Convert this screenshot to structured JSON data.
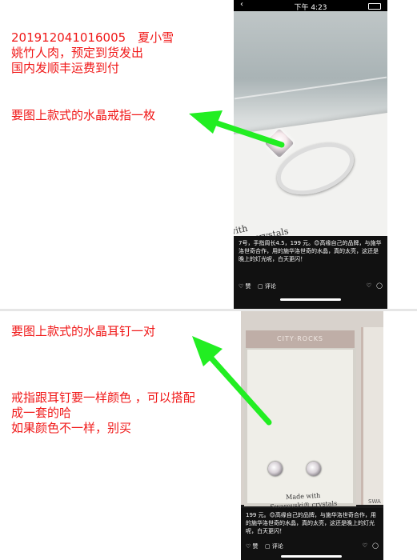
{
  "notes": {
    "order_line1": "201912041016005　夏小雪",
    "order_line2": "姚竹人肉，预定到货发出",
    "order_line3": "国内发顺丰运费到付",
    "ring_request": "要图上款式的水晶戒指一枚",
    "earring_request": "要图上款式的水晶耳钉一对",
    "color_line1": "戒指跟耳钉要一样颜色 ，可以搭配",
    "color_line2": "成一套的哈",
    "color_line3": "如果颜色不一样，别买"
  },
  "colors": {
    "note_text": "#f01818",
    "arrow": "#22ee22"
  },
  "phone_top": {
    "status_time": "下午 4:23",
    "back_glyph": "‹",
    "box_print": "with\nski® crystals",
    "caption": "7号，手指周长4.5，199 元。😊高缘自己的品牌，与施华洛世奇合作，用的施华洛世奇的水晶，真的太亮，这还是晚上的灯光呢，白天更闪！",
    "like_label": "♡ 赞",
    "comment_label": "▢ 评论",
    "heart_icon": "♡",
    "share_icon": "◯"
  },
  "phone_bottom": {
    "box_lid": "CITY·ROCKS",
    "box_print": "Made with\nSwarovski® crystals",
    "side_label": "SWA",
    "caption": "199 元。😊高缘自己的品牌，与施华洛世奇合作，用的施华洛世奇的水晶，真的太亮，这还是晚上的灯光呢，白天更闪！",
    "like_label": "♡ 赞",
    "comment_label": "▢ 评论",
    "heart_icon": "♡",
    "share_icon": "◯"
  }
}
